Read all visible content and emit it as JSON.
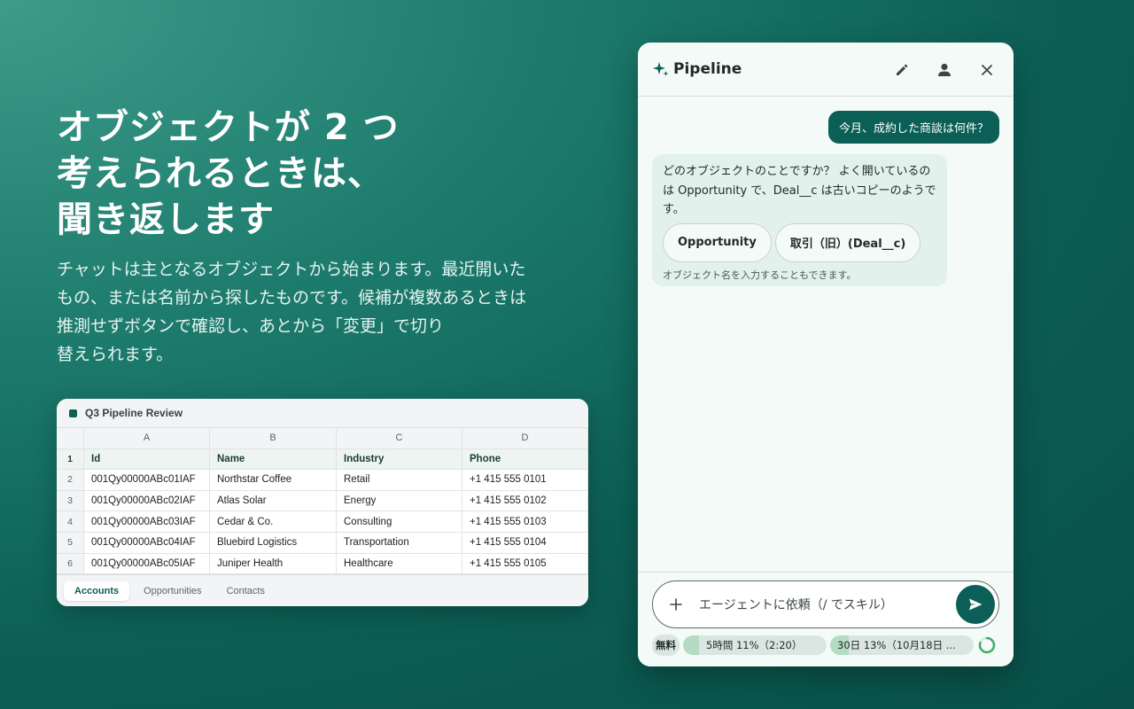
{
  "hero": {
    "title": "オブジェクトが 2 つ\n考えられるときは、\n聞き返します",
    "body": "チャットは主となるオブジェクトから始まります。最近開いた\nもの、または名前から探したものです。候補が複数あるときは\n推測せずボタンで確認し、あとから「変更」で切り\n替えられます。"
  },
  "sheet": {
    "title": "Q3 Pipeline Review",
    "columns": [
      "A",
      "B",
      "C",
      "D"
    ],
    "header_row": {
      "num": "1",
      "cells": [
        "Id",
        "Name",
        "Industry",
        "Phone"
      ]
    },
    "rows": [
      {
        "num": "2",
        "cells": [
          "001Qy00000ABc01IAF",
          "Northstar Coffee",
          "Retail",
          "+1 415 555 0101"
        ]
      },
      {
        "num": "3",
        "cells": [
          "001Qy00000ABc02IAF",
          "Atlas Solar",
          "Energy",
          "+1 415 555 0102"
        ]
      },
      {
        "num": "4",
        "cells": [
          "001Qy00000ABc03IAF",
          "Cedar & Co.",
          "Consulting",
          "+1 415 555 0103"
        ]
      },
      {
        "num": "5",
        "cells": [
          "001Qy00000ABc04IAF",
          "Bluebird Logistics",
          "Transportation",
          "+1 415 555 0104"
        ]
      },
      {
        "num": "6",
        "cells": [
          "001Qy00000ABc05IAF",
          "Juniper Health",
          "Healthcare",
          "+1 415 555 0105"
        ]
      }
    ],
    "tabs": [
      "Accounts",
      "Opportunities",
      "Contacts"
    ],
    "active_tab": "Accounts"
  },
  "chat": {
    "title": "Pipeline",
    "icons": {
      "header": "sparkle-icon",
      "edit": "pencil-icon",
      "account": "person-icon",
      "close": "close-icon",
      "add": "plus-icon",
      "send": "send-icon",
      "usage": "progress-ring-icon"
    },
    "user_message": "今月、成約した商談は何件？",
    "bot_message": "どのオブジェクトのことですか？ よく開いているのは Opportunity で、Deal__c は古いコピーのようです。",
    "choices": [
      "Opportunity",
      "取引（旧）(Deal__c)"
    ],
    "hint": "オブジェクト名を入力することもできます。",
    "composer_placeholder": "エージェントに依頼（/ でスキル）",
    "usage": {
      "plan": "無料",
      "five_hour": {
        "label": "5時間 11%（2:20）",
        "percent": 11
      },
      "thirty_day": {
        "label": "30日 13%（10月18日 ...",
        "percent": 13
      }
    }
  },
  "colors": {
    "accent": "#0b5f56",
    "panel_bg": "#f4faf8",
    "bot_bubble": "#e2f1ec",
    "meter_fill": "#b3dcc3"
  }
}
